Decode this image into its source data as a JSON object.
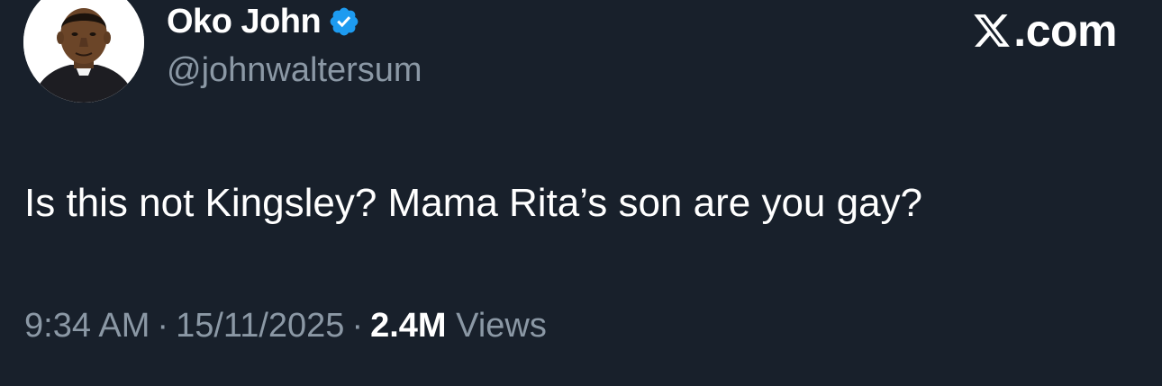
{
  "author": {
    "display_name": "Oko John",
    "handle": "@johnwaltersum",
    "verified": true,
    "avatar_icon": "profile-photo-priest"
  },
  "brand": {
    "icon": "x-logo-icon",
    "domain": ".com"
  },
  "tweet": {
    "text": "Is this not Kingsley? Mama Rita’s son are you gay?",
    "time": "9:34 AM",
    "separator": "·",
    "date": "15/11/2025",
    "views_count": "2.4M",
    "views_label": "Views"
  },
  "colors": {
    "background": "#18202b",
    "primary_text": "#ffffff",
    "secondary_text": "#8b98a5",
    "verified_blue": "#1d9bf0"
  }
}
